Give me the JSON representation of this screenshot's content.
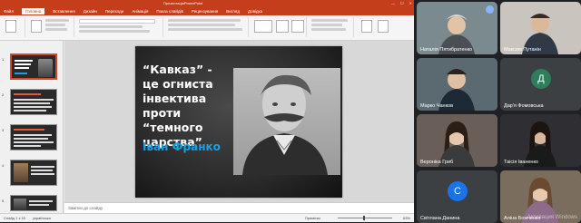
{
  "app": {
    "title": "ПрезентаціяPowerPoint",
    "window_controls": [
      "—",
      "☐",
      "✕"
    ]
  },
  "ribbon": {
    "tabs": [
      "Файл",
      "Головна",
      "Вставлення",
      "Дизайн",
      "Переходи",
      "Анімація",
      "Показ слайдів",
      "Рецензування",
      "Вигляд",
      "Довідка"
    ]
  },
  "thumbnails": [
    {
      "num": "1",
      "selected": true
    },
    {
      "num": "2",
      "selected": false
    },
    {
      "num": "3",
      "selected": false
    },
    {
      "num": "4",
      "selected": false
    },
    {
      "num": "5",
      "selected": false
    }
  ],
  "slide": {
    "title": "“Кавказ” - це огниста інвектива проти “темного царства”",
    "author": "Іван Франко"
  },
  "notes": {
    "placeholder": "Замітки до слайду"
  },
  "status": {
    "slide_info": "Слайд 1 з 15",
    "language": "українська",
    "notes_label": "Примітки",
    "zoom": "63%"
  },
  "participants": [
    {
      "name": "Наталія Пятибратенко",
      "type": "video",
      "bg": "#6b5a4a"
    },
    {
      "name": "Максим Путанін",
      "type": "video",
      "bg": "#8a8f94"
    },
    {
      "name": "Марко Чанков",
      "type": "video",
      "bg": "#5b6a70"
    },
    {
      "name": "Дар'я Фомовська",
      "type": "avatar",
      "letter": "Д",
      "color": "#2e7d5b"
    },
    {
      "name": "Вероніка Гриб",
      "type": "video",
      "bg": "#6a5f58"
    },
    {
      "name": "Таісія Іваненко",
      "type": "video",
      "bg": "#2f2f33"
    },
    {
      "name": "Світлана Данина",
      "type": "avatar",
      "letter": "С",
      "color": "#1a73e8"
    },
    {
      "name": "Аліна Божченко",
      "type": "video",
      "bg": "#7a6d5e"
    }
  ],
  "watermark": "Активация Windows"
}
